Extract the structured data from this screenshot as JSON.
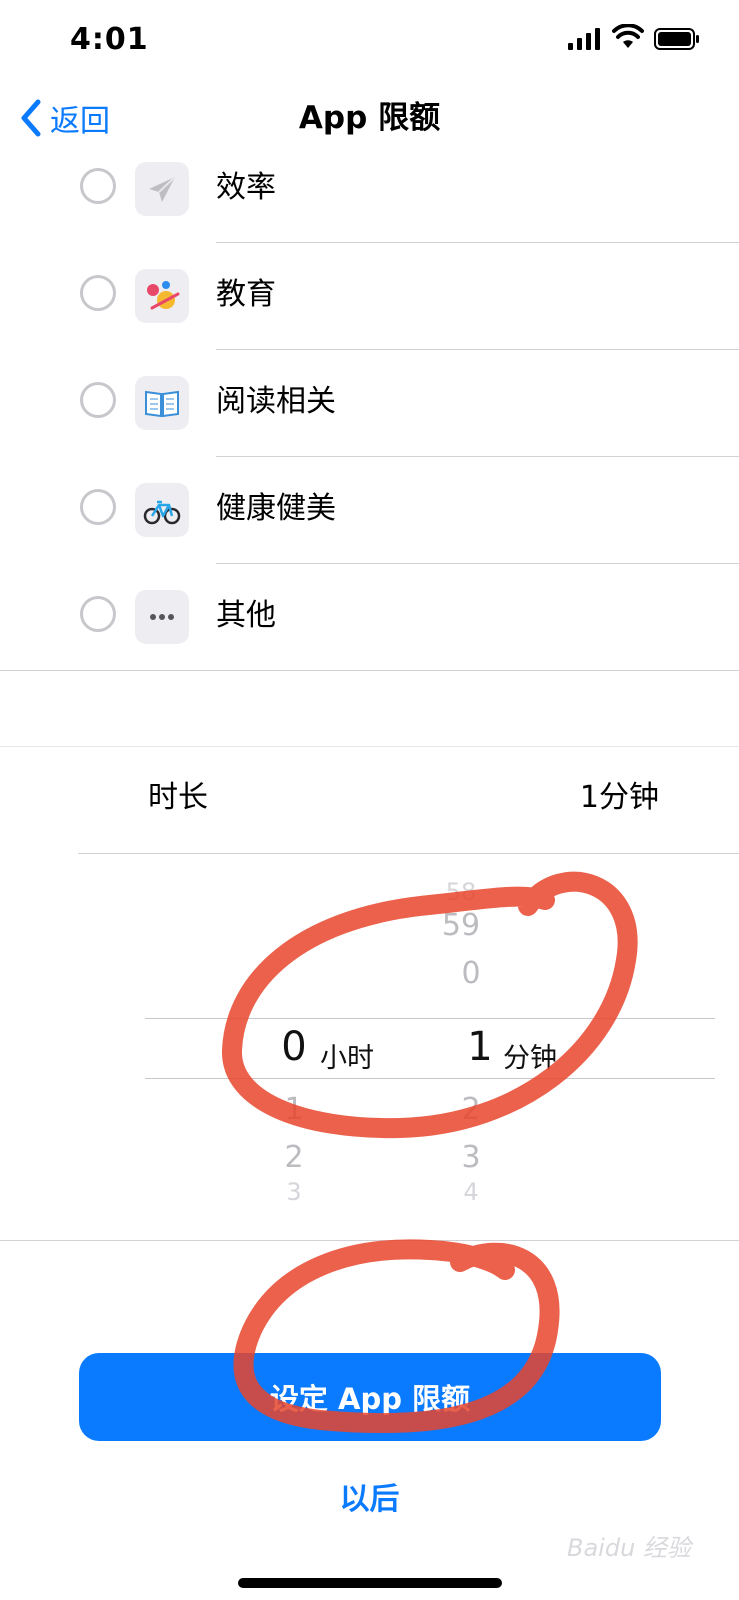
{
  "status_bar": {
    "time": "4:01"
  },
  "nav": {
    "back_label": "返回",
    "title": "App 限额"
  },
  "categories": [
    {
      "label": "效率",
      "icon": "paper-plane-icon"
    },
    {
      "label": "教育",
      "icon": "planet-icon"
    },
    {
      "label": "阅读相关",
      "icon": "book-icon"
    },
    {
      "label": "健康健美",
      "icon": "bicycle-icon"
    },
    {
      "label": "其他",
      "icon": "ellipsis-icon"
    }
  ],
  "duration": {
    "label": "时长",
    "value": "1分钟"
  },
  "picker": {
    "hours": {
      "above": [],
      "selected": "0",
      "below": [
        "1",
        "2",
        "3"
      ],
      "unit": "小时"
    },
    "minutes": {
      "above": [
        "58",
        "59",
        "0"
      ],
      "selected": "1",
      "below": [
        "2",
        "3",
        "4"
      ],
      "unit": "分钟"
    }
  },
  "buttons": {
    "primary": "设定 App 限额",
    "later": "以后"
  },
  "watermark": "Baidu 经验",
  "colors": {
    "accent": "#0a7aff",
    "annotation": "#e8452c"
  }
}
